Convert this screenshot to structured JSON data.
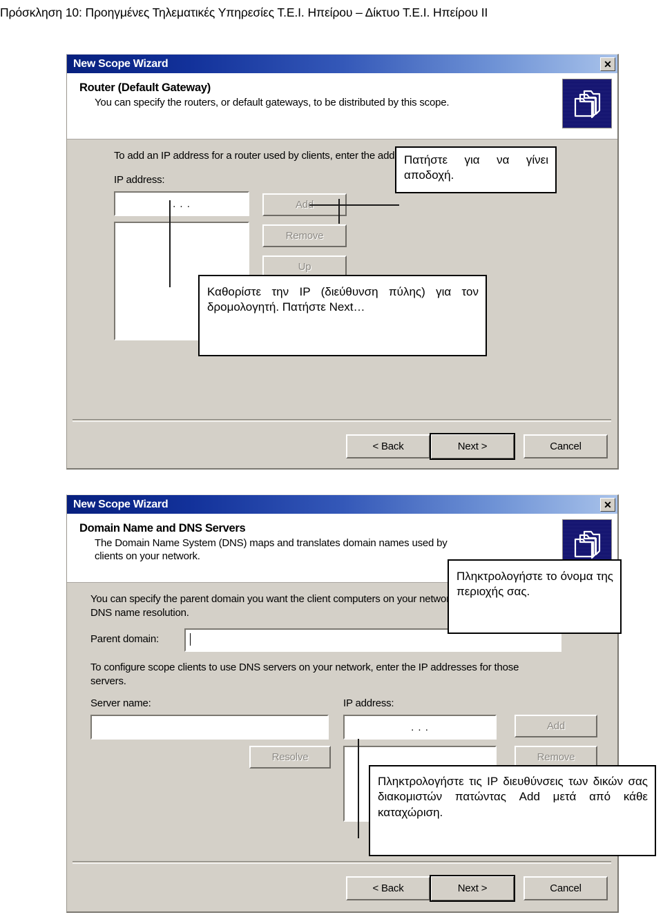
{
  "page": {
    "header": "Πρόσκληση 10: Προηγμένες Τηλεματικές Υπηρεσίες Τ.Ε.Ι. Ηπείρου – Δίκτυο Τ.Ε.Ι. Ηπείρου ΙΙ"
  },
  "colors": {
    "dialog_face": "#d4d0c8",
    "titlebar_start": "#07207e",
    "titlebar_end": "#a8c2ea",
    "wizard_icon_bg": "#0b0b6b",
    "disabled_text": "#8d8a84"
  },
  "dialog1": {
    "title": "New Scope Wizard",
    "close_label": "✕",
    "icon_name": "folders-icon",
    "heading": "Router (Default Gateway)",
    "subheading": "You can specify the routers, or default gateways, to be distributed by this scope.",
    "intro": "To add an IP address for a router used by clients, enter the address below.",
    "ip_label": "IP address:",
    "ip_value": ".   .   .",
    "buttons": {
      "add": "Add",
      "remove": "Remove",
      "up": "Up"
    },
    "footer": {
      "back": "< Back",
      "next": "Next >",
      "cancel": "Cancel"
    },
    "callouts": {
      "accept": "Πατήστε για να γίνει αποδοχή.",
      "gateway": "Καθορίστε την IP (διεύθυνση πύλης) για τον δρομολογητή. Πατήστε Next…"
    }
  },
  "dialog2": {
    "title": "New Scope Wizard",
    "close_label": "✕",
    "icon_name": "folders-icon",
    "heading": "Domain Name and DNS Servers",
    "subheading_line1": "The Domain Name System (DNS) maps and translates domain names used by",
    "subheading_line2": "clients on your network.",
    "intro_line1": "You can specify the parent domain you want the client computers on your network to use for",
    "intro_line2": "DNS name resolution.",
    "parent_domain_label": "Parent domain:",
    "parent_domain_value": "",
    "dns_intro_line1": "To configure scope clients to use DNS servers on your network, enter the IP addresses for those",
    "dns_intro_line2": "servers.",
    "server_name_label": "Server name:",
    "server_name_value": "",
    "ip_label": "IP address:",
    "ip_value": ".   .   .",
    "buttons": {
      "resolve": "Resolve",
      "add": "Add",
      "remove": "Remove"
    },
    "footer": {
      "back": "< Back",
      "next": "Next >",
      "cancel": "Cancel"
    },
    "callouts": {
      "domain_name": "Πληκτρολογήστε το όνομα της περιοχής σας.",
      "dns_servers": "Πληκτρολογήστε τις IP διευθύνσεις των δικών σας διακομιστών πατώντας Add μετά από κάθε καταχώριση."
    }
  }
}
